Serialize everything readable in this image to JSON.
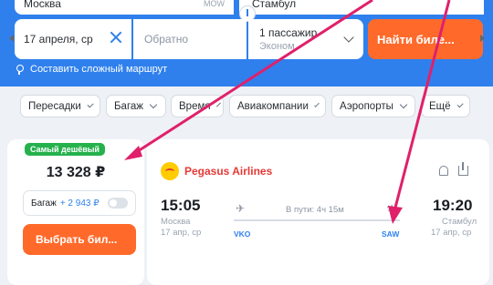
{
  "search": {
    "from_city": "Москва",
    "from_code": "MOW",
    "to_city": "Стамбул",
    "depart_date": "17 апреля, ср",
    "return_placeholder": "Обратно",
    "passengers": "1 пассажир",
    "cabin_class": "Эконом",
    "search_button": "Найти биле..."
  },
  "complex_route_link": "Составить сложный маршрут",
  "filters": [
    "Пересадки",
    "Багаж",
    "Время",
    "Авиакомпании",
    "Аэропорты",
    "Ещё"
  ],
  "offer": {
    "badge": "Самый дешёвый",
    "price": "13 328 ₽",
    "baggage_label": "Багаж",
    "baggage_price": "+ 2 943 ₽",
    "select_button": "Выбрать бил..."
  },
  "flight": {
    "airline": "Pegasus Airlines",
    "departure_time": "15:05",
    "arrival_time": "19:20",
    "duration": "В пути: 4ч 15м",
    "departure_city": "Москва",
    "arrival_city": "Стамбул",
    "departure_date": "17 апр, ср",
    "arrival_date": "17 апр, ср",
    "departure_airport": "VKO",
    "arrival_airport": "SAW"
  },
  "colors": {
    "header_blue": "#2f80ed",
    "accent_orange": "#ff6a2b",
    "badge_green": "#25b14c",
    "airline_red": "#e53935",
    "annotation_magenta": "#e0206a"
  },
  "icons": [
    "swap-icon",
    "clear-icon",
    "chevron-down-icon",
    "route-icon",
    "bell-icon",
    "share-icon",
    "plane-takeoff-icon",
    "plane-landing-icon",
    "airline-logo"
  ]
}
